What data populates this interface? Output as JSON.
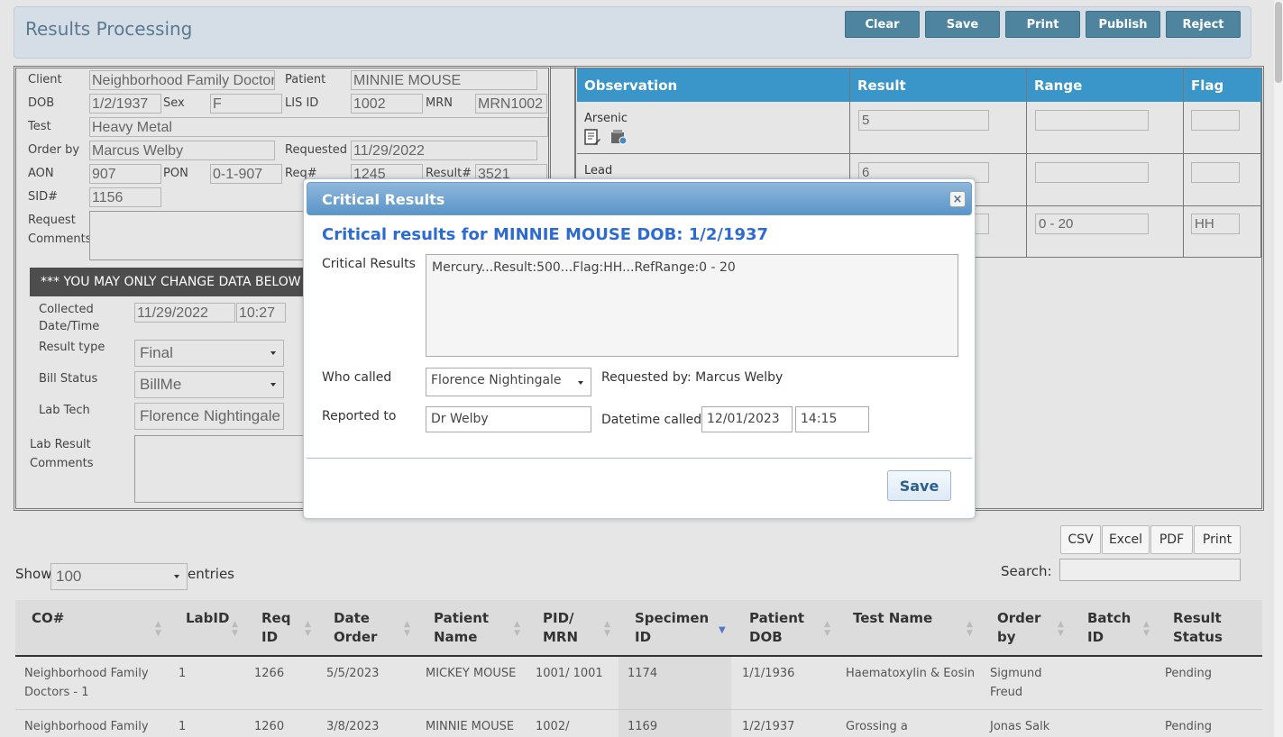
{
  "header": {
    "title": "Results Processing",
    "buttons": [
      "Clear",
      "Save",
      "Print",
      "Publish",
      "Reject"
    ]
  },
  "form": {
    "client_label": "Client",
    "client_value": "Neighborhood Family Doctors",
    "patient_label": "Patient",
    "patient_value": "MINNIE MOUSE",
    "dob_label": "DOB",
    "dob_value": "1/2/1937",
    "sex_label": "Sex",
    "sex_value": "F",
    "lisid_label": "LIS ID",
    "lisid_value": "1002",
    "mrn_label": "MRN",
    "mrn_value": "MRN1002",
    "test_label": "Test",
    "test_value": "Heavy Metal",
    "orderby_label": "Order by",
    "orderby_value": "Marcus Welby",
    "requested_label": "Requested",
    "requested_value": "11/29/2022",
    "aon_label": "AON",
    "aon_value": "907",
    "pon_label": "PON",
    "pon_value": "0-1-907",
    "req_label": "Req#",
    "req_value": "1245",
    "result_label": "Result#",
    "result_value": "3521",
    "sid_label": "SID#",
    "sid_value": "1156",
    "request_comments_label_1": "Request",
    "request_comments_label_2": "Comments",
    "banner": "*** YOU MAY ONLY CHANGE DATA BELOW THIS LINE",
    "collected_label_1": "Collected",
    "collected_label_2": "Date/Time",
    "collected_date": "11/29/2022",
    "collected_time": "10:27",
    "result_type_label": "Result type",
    "result_type_value": "Final",
    "bill_status_label": "Bill Status",
    "bill_status_value": "BillMe",
    "lab_tech_label": "Lab Tech",
    "lab_tech_value": "Florence Nightingale",
    "lab_comments_label_1": "Lab Result",
    "lab_comments_label_2": "Comments"
  },
  "observations": {
    "headers": [
      "Observation",
      "Result",
      "Range",
      "Flag"
    ],
    "rows": [
      {
        "name": "Arsenic",
        "result": "5",
        "range": "",
        "flag": ""
      },
      {
        "name": "Lead",
        "result": "6",
        "range": "",
        "flag": ""
      },
      {
        "name": "",
        "result": "",
        "range": "0 - 20",
        "flag": "HH"
      }
    ]
  },
  "export_buttons": [
    "CSV",
    "Excel",
    "PDF",
    "Print"
  ],
  "list": {
    "show_label": "Show",
    "show_value": "100",
    "entries_label": "entries",
    "search_label": "Search:",
    "columns": [
      [
        "CO#",
        ""
      ],
      [
        "LabID",
        ""
      ],
      [
        "Req",
        "ID"
      ],
      [
        "Date",
        "Order"
      ],
      [
        "Patient",
        "Name"
      ],
      [
        "PID/",
        "MRN"
      ],
      [
        "Specimen",
        "ID"
      ],
      [
        "Patient",
        "DOB"
      ],
      [
        "Test Name",
        ""
      ],
      [
        "Order",
        "by"
      ],
      [
        "Batch",
        "ID"
      ],
      [
        "Result",
        "Status"
      ]
    ],
    "rows": [
      {
        "co": [
          "Neighborhood Family",
          "Doctors - 1"
        ],
        "labid": "1",
        "req": "1266",
        "date": "5/5/2023",
        "patient": "MICKEY MOUSE",
        "pid": "1001/ 1001",
        "specimen": "1174",
        "dob": "1/1/1936",
        "test": "Haematoxylin & Eosin",
        "order": [
          "Sigmund",
          "Freud"
        ],
        "batch": "",
        "status": "Pending"
      },
      {
        "co": [
          "Neighborhood Family",
          ""
        ],
        "labid": "1",
        "req": "1260",
        "date": "3/8/2023",
        "patient": "MINNIE MOUSE",
        "pid": "1002/",
        "specimen": "1169",
        "dob": "1/2/1937",
        "test": "Grossing a",
        "order": [
          "Jonas Salk",
          ""
        ],
        "batch": "",
        "status": "Pending"
      }
    ]
  },
  "modal": {
    "title": "Critical Results",
    "heading": "Critical results for MINNIE MOUSE DOB: 1/2/1937",
    "critical_label": "Critical Results",
    "critical_text": "Mercury...Result:500...Flag:HH...RefRange:0 - 20",
    "who_called_label": "Who called",
    "who_called_value": "Florence Nightingale",
    "requested_by": "Requested by: Marcus Welby",
    "reported_to_label": "Reported to",
    "reported_to_value": "Dr Welby",
    "datetime_label": "Datetime called",
    "date_value": "12/01/2023",
    "time_value": "14:15",
    "save_label": "Save"
  },
  "colors": {
    "accent": "#4f849f",
    "table_header": "#3a95c8",
    "modal_heading": "#2e6bd1"
  }
}
